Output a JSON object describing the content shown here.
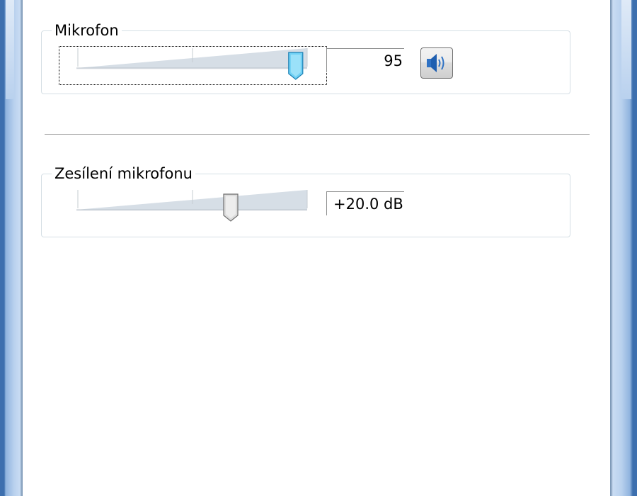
{
  "microphone": {
    "title": "Mikrofon",
    "level": 95,
    "level_max": 100,
    "value_text": "95",
    "mute_icon": "speaker-icon"
  },
  "boost": {
    "title": "Zesílení mikrofonu",
    "value_db": 20.0,
    "range_db": [
      0,
      30
    ],
    "value_text": "+20.0 dB"
  },
  "colors": {
    "frame": "#3d6fae",
    "slider_fill": "#cdd7e0",
    "thumb_active": "#6fd0f4",
    "thumb_inactive": "#d6d6d6"
  }
}
